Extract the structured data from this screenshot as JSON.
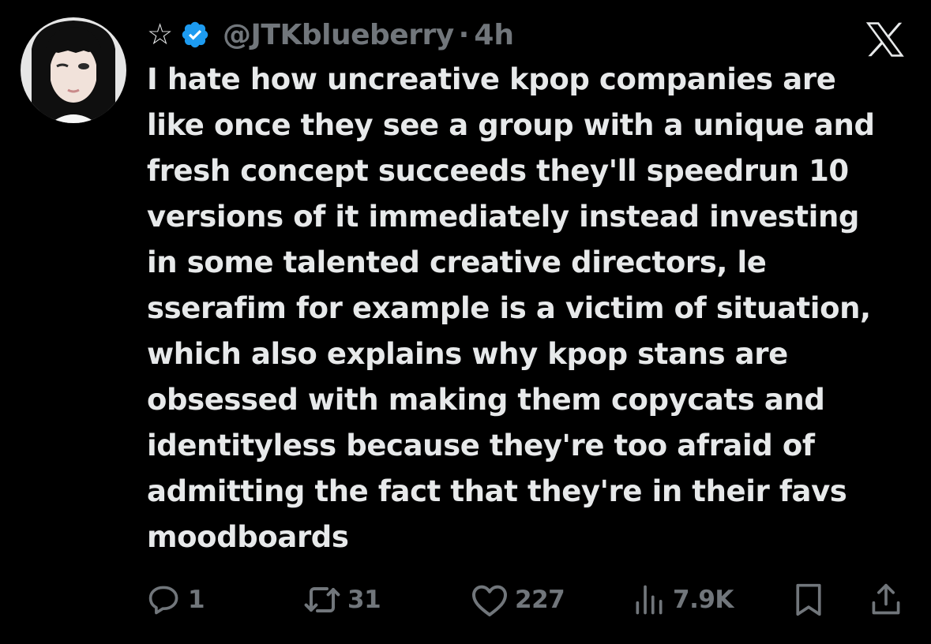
{
  "post": {
    "header": {
      "star_glyph": "☆",
      "verified_icon": "verified-badge-icon",
      "handle": "@JTKblueberry",
      "separator": "·",
      "time": "4h",
      "brand_icon": "x-logo-icon"
    },
    "text_lines": [
      "I hate how uncreative kpop companies are",
      "like once they see a group with a unique and",
      "fresh concept succeeds they'll speedrun 10",
      "versions of it immediately instead investing",
      "in some talented creative directors, le",
      "sserafim for example is a victim of situation,",
      "which also explains why kpop stans are",
      "obsessed with making them copycats and",
      "identityless because they're too afraid of",
      "admitting the fact that they're in their favs",
      "moodboards"
    ],
    "actions": {
      "reply": {
        "icon": "reply-icon",
        "count": "1"
      },
      "repost": {
        "icon": "repost-icon",
        "count": "31"
      },
      "like": {
        "icon": "heart-icon",
        "count": "227"
      },
      "views": {
        "icon": "views-icon",
        "count": "7.9K"
      },
      "bookmark": {
        "icon": "bookmark-icon"
      },
      "share": {
        "icon": "share-icon"
      }
    }
  },
  "colors": {
    "background": "#000000",
    "text": "#e7e9ea",
    "muted": "#71767b",
    "verified": "#1d9bf0"
  }
}
